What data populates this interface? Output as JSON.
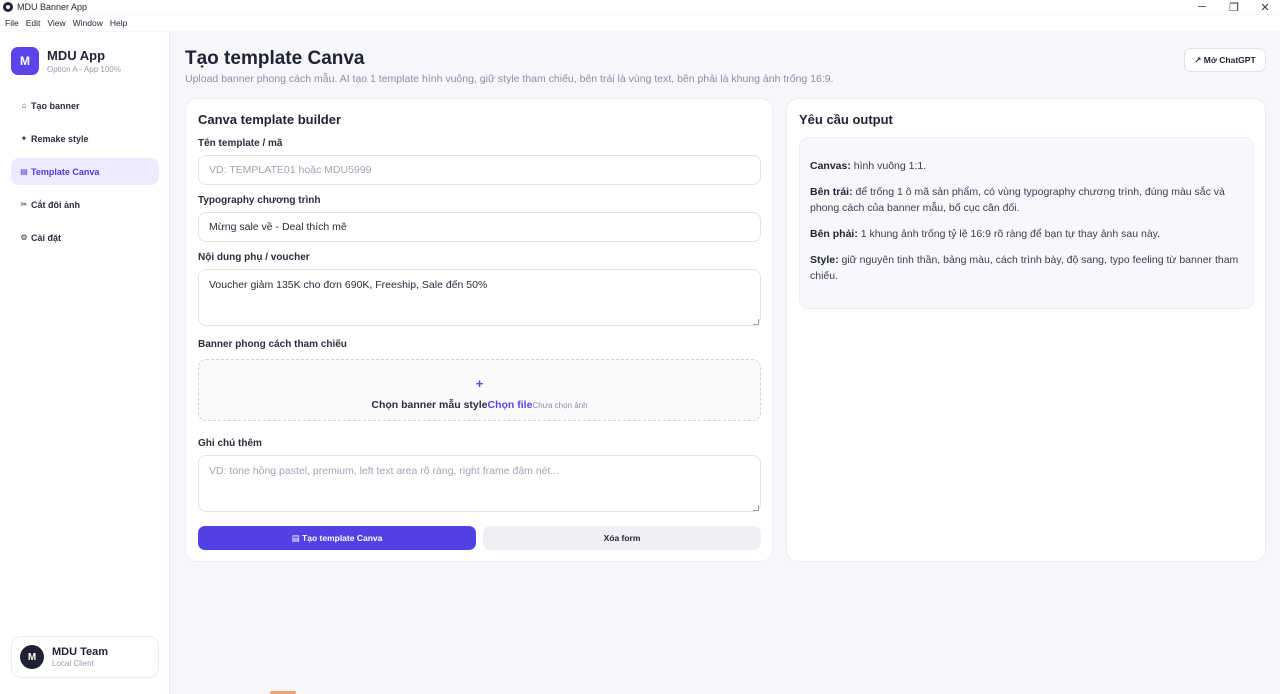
{
  "window": {
    "title": "MDU Banner App",
    "controls": {
      "minimize": "─",
      "restore": "❐",
      "close": "✕"
    }
  },
  "menu": [
    "File",
    "Edit",
    "View",
    "Window",
    "Help"
  ],
  "sidebar": {
    "brand": {
      "badge": "M",
      "title": "MDU App",
      "subtitle": "Option A - App 100%"
    },
    "items": [
      {
        "icon": "⌂",
        "label": "Tạo banner",
        "active": false
      },
      {
        "icon": "✦",
        "label": "Remake style",
        "active": false
      },
      {
        "icon": "▤",
        "label": "Template Canva",
        "active": true
      },
      {
        "icon": "✂",
        "label": "Cắt đôi ảnh",
        "active": false
      },
      {
        "icon": "⚙",
        "label": "Cài đặt",
        "active": false
      }
    ],
    "user": {
      "avatar": "M",
      "name": "MDU Team",
      "subtitle": "Local Client"
    }
  },
  "header": {
    "title": "Tạo template Canva",
    "subtitle": "Upload banner phong cách mẫu. AI tạo 1 template hình vuông, giữ style tham chiếu, bên trái là vùng text, bên phải là khung ảnh trống 16:9.",
    "chatgpt_button": "↗ Mở ChatGPT"
  },
  "builder": {
    "title": "Canva template builder",
    "fields": {
      "name": {
        "label": "Tên template / mã",
        "value": "",
        "placeholder": "VD: TEMPLATE01 hoặc MDU5999"
      },
      "typography": {
        "label": "Typography chương trình",
        "value": "Mừng sale về - Deal thích mê",
        "placeholder": ""
      },
      "voucher": {
        "label": "Nội dung phụ / voucher",
        "value": "Voucher giảm 135K cho đơn 690K, Freeship, Sale đến 50%",
        "placeholder": ""
      },
      "reference": {
        "label": "Banner phong cách tham chiếu",
        "plus": "+",
        "title": "Chọn banner mẫu style",
        "link": "Chọn file",
        "note": "Chưa chọn ảnh"
      },
      "notes": {
        "label": "Ghi chú thêm",
        "value": "",
        "placeholder": "VD: tone hồng pastel, premium, left text area rõ ràng, right frame đậm nét..."
      }
    },
    "create_button": "▤ Tạo template Canva",
    "clear_button": "Xóa form"
  },
  "output": {
    "title": "Yêu cầu output",
    "items": [
      {
        "key": "Canvas:",
        "text": " hình vuông 1:1."
      },
      {
        "key": "Bên trái:",
        "text": " để trống 1 ô mã sản phẩm, có vùng typography chương trình, đúng màu sắc và phong cách của banner mẫu, bố cục cân đối."
      },
      {
        "key": "Bên phải:",
        "text": " 1 khung ảnh trống tỷ lệ 16:9 rõ ràng để bạn tự thay ảnh sau này."
      },
      {
        "key": "Style:",
        "text": " giữ nguyên tinh thần, bảng màu, cách trình bày, độ sang, typo feeling từ banner tham chiếu."
      }
    ]
  },
  "colors": {
    "accent": "#5242e6",
    "active_bg": "#ecebff",
    "background": "#f6f6fb"
  }
}
